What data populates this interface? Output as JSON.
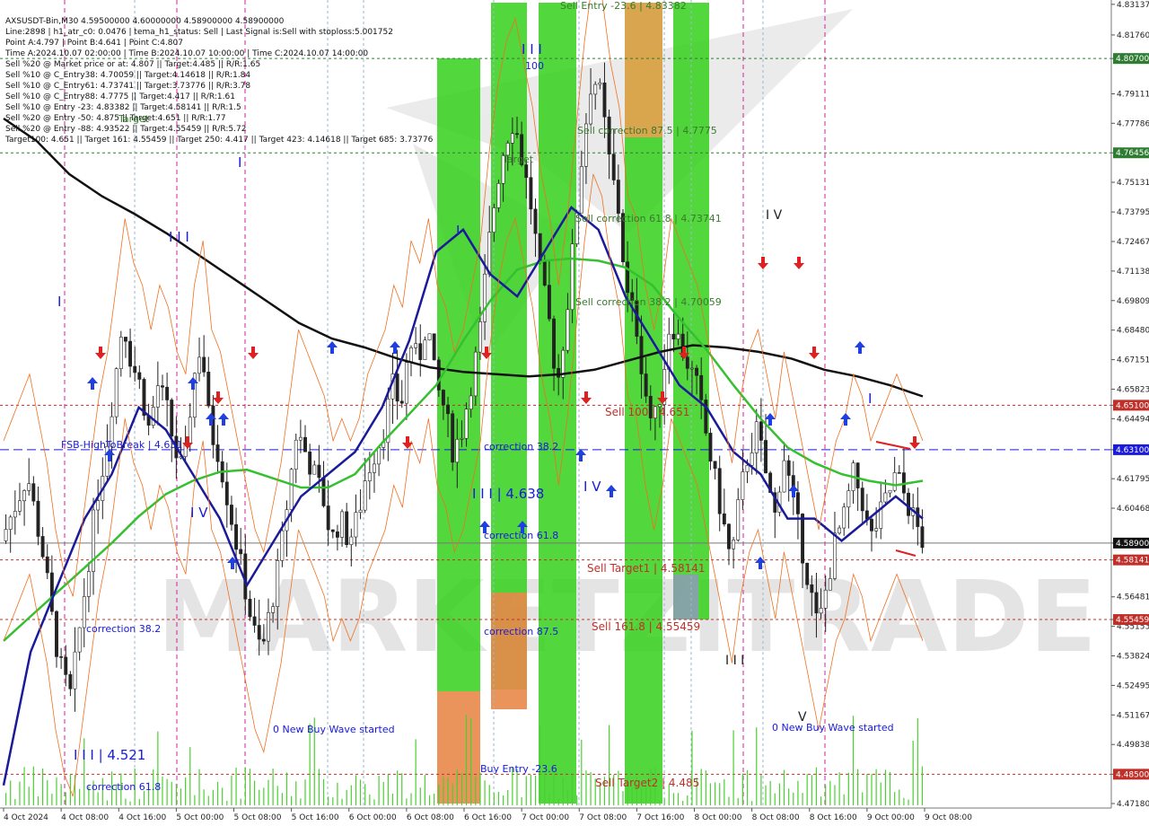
{
  "info_lines": [
    "AXSUSDT-Bin,M30  4.59500000 4.60000000 4.58900000 4.58900000",
    "Line:2898 | h1_atr_c0: 0.0476 | tema_h1_status: Sell | Last Signal is:Sell with stoploss:5.001752",
    "Point A:4.797 | Point B:4.641 | Point C:4.807",
    "Time A:2024.10.07 02:00:00 | Time B:2024.10.07 10:00:00 | Time C:2024.10.07 14:00:00",
    "Sell %20 @ Market price or at: 4.807 || Target:4.485 || R/R:1.65",
    "Sell %10 @ C_Entry38: 4.70059 || Target:4.14618 || R/R:1.84",
    "Sell %10 @ C_Entry61: 4.73741 || Target:3.73776 || R/R:3.78",
    "Sell %10 @ C_Entry88: 4.7775 || Target:4.417 || R/R:1.61",
    "Sell %10 @ Entry -23: 4.83382 || Target:4.58141 || R/R:1.5",
    "Sell %20 @ Entry -50: 4.875 || Target:4.651 || R/R:1.77",
    "Sell %20 @ Entry -88: 4.93522 || Target:4.55459 || R/R:5.72",
    "Target100: 4.651 || Target 161: 4.55459 || Target 250: 4.417 || Target 423: 4.14618 || Target 685: 3.73776"
  ],
  "watermark": "MARKETZITRADE",
  "chart_data": {
    "type": "candlestick",
    "symbol": "AXSUSDT-Bin",
    "timeframe": "M30",
    "ylim": [
      4.4718,
      4.8313
    ],
    "y_ticks": [
      "4.83137",
      "4.81760",
      "4.80700",
      "4.79111",
      "4.77786",
      "4.76456",
      "4.75131",
      "4.73795",
      "4.72467",
      "4.71138",
      "4.69809",
      "4.68480",
      "4.67151",
      "4.65823",
      "4.65100",
      "4.64494",
      "4.63100",
      "4.61795",
      "4.60468",
      "4.58900",
      "4.58141",
      "4.56481",
      "4.55459",
      "4.55153",
      "4.53824",
      "4.52495",
      "4.51167",
      "4.49838",
      "4.48500",
      "4.47180"
    ],
    "x_ticks": [
      "4 Oct 2024",
      "4 Oct 08:00",
      "4 Oct 16:00",
      "5 Oct 00:00",
      "5 Oct 08:00",
      "5 Oct 16:00",
      "6 Oct 00:00",
      "6 Oct 08:00",
      "6 Oct 16:00",
      "7 Oct 00:00",
      "7 Oct 08:00",
      "7 Oct 16:00",
      "8 Oct 00:00",
      "8 Oct 08:00",
      "8 Oct 16:00",
      "9 Oct 00:00",
      "9 Oct 08:00"
    ],
    "close_series": [
      4.59,
      4.6,
      4.61,
      4.62,
      4.6,
      4.58,
      4.55,
      4.53,
      4.52,
      4.55,
      4.58,
      4.61,
      4.63,
      4.66,
      4.69,
      4.67,
      4.66,
      4.64,
      4.66,
      4.65,
      4.63,
      4.62,
      4.66,
      4.68,
      4.64,
      4.63,
      4.61,
      4.59,
      4.57,
      4.55,
      4.54,
      4.56,
      4.58,
      4.61,
      4.64,
      4.63,
      4.62,
      4.61,
      4.59,
      4.6,
      4.59,
      4.6,
      4.62,
      4.63,
      4.64,
      4.66,
      4.65,
      4.68,
      4.67,
      4.69,
      4.66,
      4.65,
      4.63,
      4.64,
      4.66,
      4.68,
      4.72,
      4.75,
      4.77,
      4.78,
      4.76,
      4.74,
      4.71,
      4.69,
      4.66,
      4.69,
      4.73,
      4.77,
      4.8,
      4.79,
      4.76,
      4.74,
      4.7,
      4.69,
      4.66,
      4.64,
      4.66,
      4.69,
      4.68,
      4.67,
      4.66,
      4.64,
      4.62,
      4.6,
      4.58,
      4.61,
      4.63,
      4.64,
      4.62,
      4.6,
      4.63,
      4.61,
      4.59,
      4.57,
      4.55,
      4.57,
      4.59,
      4.6,
      4.62,
      4.61,
      4.59,
      4.6,
      4.61,
      4.62,
      4.61,
      4.6,
      4.59
    ],
    "ema_slow": [
      4.78,
      4.77,
      4.755,
      4.745,
      4.737,
      4.728,
      4.718,
      4.708,
      4.698,
      4.688,
      4.681,
      4.677,
      4.672,
      4.668,
      4.666,
      4.665,
      4.664,
      4.665,
      4.667,
      4.671,
      4.675,
      4.678,
      4.677,
      4.675,
      4.672,
      4.667,
      4.664,
      4.66,
      4.655
    ],
    "ema_mid": [
      4.545,
      4.556,
      4.567,
      4.578,
      4.589,
      4.601,
      4.611,
      4.617,
      4.621,
      4.622,
      4.618,
      4.614,
      4.614,
      4.62,
      4.634,
      4.647,
      4.66,
      4.68,
      4.698,
      4.712,
      4.716,
      4.717,
      4.716,
      4.713,
      4.705,
      4.69,
      4.676,
      4.66,
      4.645,
      4.632,
      4.625,
      4.62,
      4.617,
      4.615,
      4.617
    ],
    "ema_fast": [
      4.48,
      4.54,
      4.57,
      4.6,
      4.62,
      4.65,
      4.64,
      4.62,
      4.6,
      4.57,
      4.59,
      4.61,
      4.62,
      4.63,
      4.65,
      4.68,
      4.72,
      4.73,
      4.71,
      4.7,
      4.72,
      4.74,
      4.73,
      4.7,
      4.68,
      4.66,
      4.65,
      4.63,
      4.62,
      4.6,
      4.6,
      4.59,
      4.6,
      4.61,
      4.6
    ],
    "levels": [
      {
        "label": "Sell Entry -23.6 | 4.83382",
        "value": 4.83382,
        "color": "#2e7d32"
      },
      {
        "label": "Sell correction 87.5 | 4.7775",
        "value": 4.7775,
        "color": "#2e7d32"
      },
      {
        "label": "Sell correction 61.8 | 4.73741",
        "value": 4.73741,
        "color": "#2e7d32"
      },
      {
        "label": "Sell correction 38.2 | 4.70059",
        "value": 4.70059,
        "color": "#2e7d32"
      },
      {
        "label": "Sell 100 | 4.651",
        "value": 4.651,
        "color": "#c0302a"
      },
      {
        "label": "Sell Target1 | 4.58141",
        "value": 4.58141,
        "color": "#c0302a"
      },
      {
        "label": "Sell 161.8 | 4.55459",
        "value": 4.55459,
        "color": "#c0302a"
      },
      {
        "label": "Sell Target2 | 4.485",
        "value": 4.485,
        "color": "#c0302a"
      }
    ],
    "hlines": [
      {
        "value": 4.807,
        "color": "#2e7d32",
        "style": "dotted",
        "tag": "4.80700"
      },
      {
        "value": 4.76456,
        "color": "#2e7d32",
        "style": "dotted",
        "tag": "4.76456"
      },
      {
        "value": 4.651,
        "color": "#c0302a",
        "style": "dotted",
        "tag": "4.65100"
      },
      {
        "value": 4.631,
        "color": "#1a1adb",
        "style": "dashed",
        "tag": "4.63100"
      },
      {
        "value": 4.589,
        "color": "#777777",
        "style": "solid",
        "tag": "4.58900"
      },
      {
        "value": 4.58141,
        "color": "#c0302a",
        "style": "dotted",
        "tag": "4.58141"
      },
      {
        "value": 4.55459,
        "color": "#c0302a",
        "style": "dotted",
        "tag": "4.55459"
      },
      {
        "value": 4.485,
        "color": "#c0302a",
        "style": "dotted",
        "tag": "4.48500"
      }
    ],
    "annotations": {
      "blue": [
        "FSB-HighToBreak | 4.631",
        "correction 38.2",
        "correction 61.8",
        "correction 87.5",
        "correction 38.2",
        "correction 61.8",
        "0 New Buy Wave started",
        "0 New Buy Wave started",
        "Buy Entry -23.6"
      ],
      "waves_blue": [
        "I",
        "I I I",
        "I",
        "I V",
        "I I I | 4.521",
        "I I I | 4.638",
        "I V",
        "I",
        "I",
        "I I I",
        "100"
      ],
      "waves_dark": [
        "I V",
        "I I I",
        "V"
      ],
      "green": [
        "Target",
        "Target"
      ]
    }
  }
}
